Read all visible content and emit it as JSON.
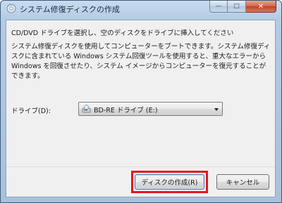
{
  "window": {
    "title": "システム修復ディスクの作成",
    "controls": {
      "minimize": "—",
      "maximize": "□",
      "close": "✕"
    }
  },
  "content": {
    "instruction": "CD/DVD ドライブを選択し、空のディスクをドライブに挿入してください",
    "description": "システム修復ディスクを使用してコンピューターをブートできます。システム修復ディスクに含まれている Windows システム回復ツールを使用すると、重大なエラーから Windows を回復させたり、システム イメージからコンピューターを復元することができます。",
    "drive_label": "ドライブ(D):",
    "drive_selected": "BD-RE ドライブ (E:)"
  },
  "buttons": {
    "create_label": "ディスクの作成(R)",
    "cancel_label": "キャンセル"
  },
  "colors": {
    "highlight": "#e8141f",
    "frame": "#b3cbe4",
    "client_bg": "#f0f0f0"
  },
  "icons": {
    "app": "disc-icon",
    "drive": "optical-drive-icon"
  }
}
